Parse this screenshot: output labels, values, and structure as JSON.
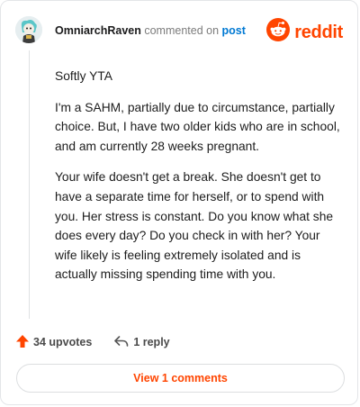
{
  "header": {
    "author": "OmniarchRaven",
    "verb": "commented on",
    "target": "post",
    "logo_word": "reddit"
  },
  "comment": {
    "paragraphs": [
      "Softly YTA",
      "I'm a SAHM, partially due to circumstance, partially choice. But, I have two older kids who are in school, and am currently 28 weeks pregnant.",
      "Your wife doesn't get a break. She doesn't get to have a separate time for herself, or to spend with you. Her stress is constant. Do you know what she does every day? Do you check in with her? Your wife likely is feeling extremely isolated and is actually missing spending time with you."
    ]
  },
  "actions": {
    "upvotes": "34 upvotes",
    "reply": "1 reply",
    "view_comments": "View 1 comments"
  },
  "colors": {
    "brand": "#ff4500",
    "link": "#0079d3"
  },
  "icons": {
    "avatar": "avatar",
    "logo": "reddit-alien-icon",
    "upvote": "upvote-arrow-icon",
    "reply": "reply-arrow-icon"
  }
}
